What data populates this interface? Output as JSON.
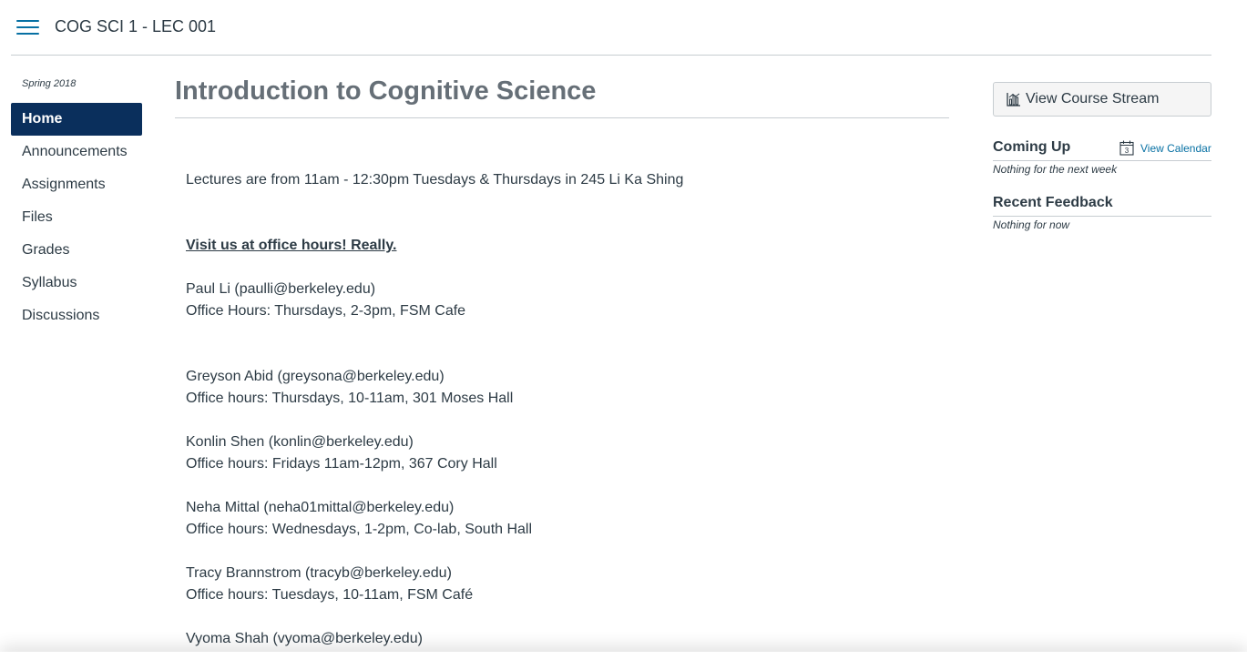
{
  "header": {
    "menu_icon": "hamburger-icon",
    "course_name": "COG SCI 1 - LEC 001"
  },
  "sidebar": {
    "term": "Spring 2018",
    "items": [
      {
        "label": "Home",
        "active": true
      },
      {
        "label": "Announcements"
      },
      {
        "label": "Assignments"
      },
      {
        "label": "Files"
      },
      {
        "label": "Grades"
      },
      {
        "label": "Syllabus"
      },
      {
        "label": "Discussions"
      }
    ]
  },
  "main": {
    "title": "Introduction to Cognitive Science",
    "lecture_info": "Lectures are from 11am - 12:30pm Tuesdays & Thursdays in 245 Li Ka Shing",
    "office_hours_heading": "Visit us at office hours! Really.",
    "staff": [
      {
        "contact": "Paul Li (paulli@berkeley.edu)",
        "hours": "Office Hours: Thursdays, 2-3pm, FSM Cafe"
      },
      {
        "contact": "Greyson Abid (greysona@berkeley.edu)",
        "hours": "Office hours: Thursdays, 10-11am, 301 Moses Hall"
      },
      {
        "contact": "Konlin Shen (konlin@berkeley.edu)",
        "hours": "Office hours: Fridays 11am-12pm, 367 Cory Hall"
      },
      {
        "contact": "Neha Mittal (neha01mittal@berkeley.edu)",
        "hours": "Office hours: Wednesdays, 1-2pm, Co-lab, South Hall"
      },
      {
        "contact": "Tracy Brannstrom (tracyb@berkeley.edu)",
        "hours": "Office hours: Tuesdays, 10-11am, FSM Café"
      },
      {
        "contact": "Vyoma Shah (vyoma@berkeley.edu)",
        "hours": ""
      }
    ]
  },
  "right_panel": {
    "stream_button_label": "View Course Stream",
    "stream_icon": "bar-chart-icon",
    "coming_up_heading": "Coming Up",
    "view_calendar_label": "View Calendar",
    "calendar_icon": "calendar-icon",
    "calendar_icon_day": "3",
    "coming_up_note": "Nothing for the next week",
    "recent_feedback_heading": "Recent Feedback",
    "recent_feedback_note": "Nothing for now"
  },
  "colors": {
    "accent": "#0770a3",
    "nav_active_bg": "#0a2f5c",
    "text": "#2d3b45",
    "title": "#666f77",
    "rule": "#c7cdd1"
  }
}
